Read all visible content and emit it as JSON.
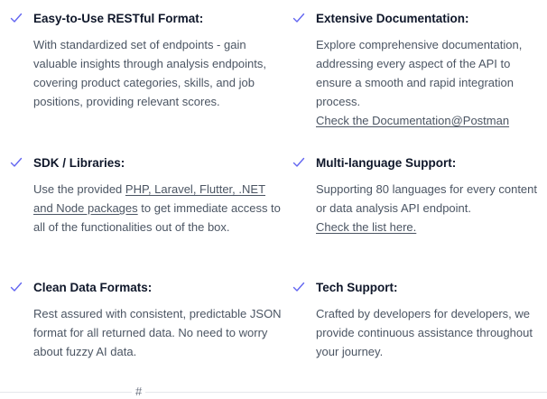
{
  "colors": {
    "check": "#6366f1",
    "title": "#0f172a",
    "text": "#4b5563"
  },
  "features": [
    {
      "title": "Easy-to-Use RESTful Format:",
      "description": "With standardized set of endpoints - gain valuable insights through analysis endpoints, covering product categories, skills, and job positions, providing relevant scores."
    },
    {
      "title": "Extensive Documentation:",
      "description": "Explore comprehensive documentation, addressing every aspect of the API to ensure a smooth and rapid integration process.",
      "link": "Check the Documentation@Postman"
    },
    {
      "title": "SDK / Libraries:",
      "description_prefix": "Use the provided ",
      "description_link": "PHP, Laravel, Flutter, .NET and Node packages",
      "description_suffix": " to get immediate access to all of the functionalities out of the box."
    },
    {
      "title": "Multi-language Support:",
      "description": "Supporting 80 languages for every content or data analysis API endpoint.",
      "link": "Check the list here."
    },
    {
      "title": "Clean Data Formats:",
      "description": "Rest assured with consistent, predictable JSON format for all returned data. No need to worry about fuzzy AI data."
    },
    {
      "title": "Tech Support:",
      "description": "Crafted by developers for developers, we provide continuous assistance throughout your journey."
    }
  ],
  "footer": {
    "hash_symbol": "#"
  }
}
